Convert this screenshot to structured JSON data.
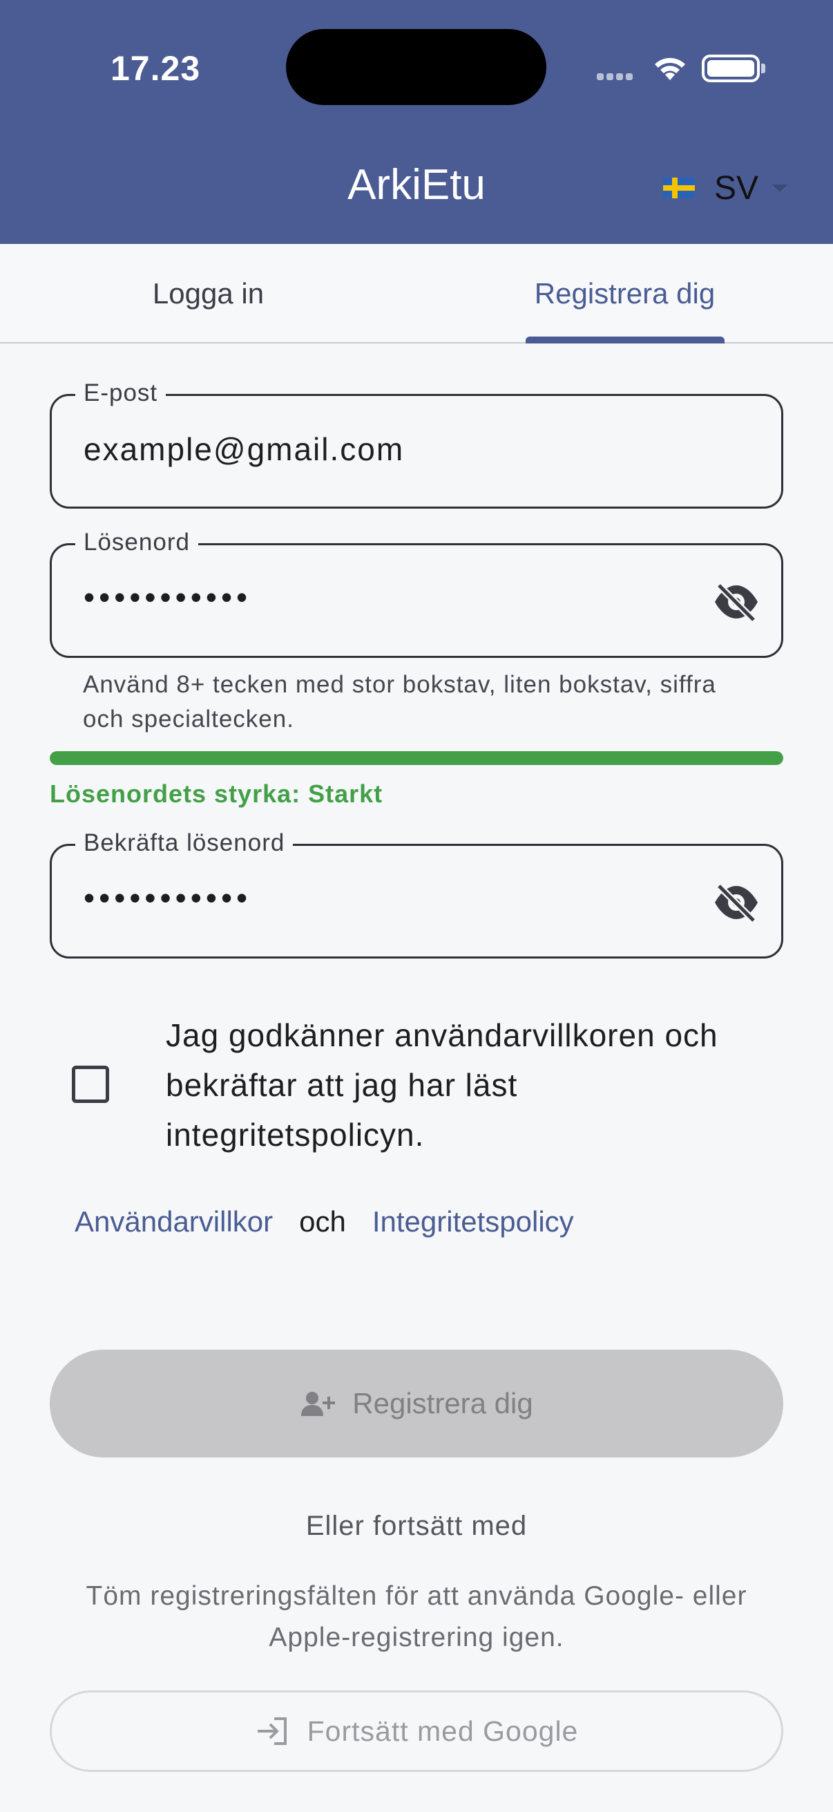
{
  "status_bar": {
    "time": "17.23"
  },
  "header": {
    "title": "ArkiEtu",
    "language_code": "SV"
  },
  "tabs": [
    {
      "label": "Logga in",
      "selected": false
    },
    {
      "label": "Registrera dig",
      "selected": true
    }
  ],
  "form": {
    "email": {
      "label": "E-post",
      "value": "example@gmail.com"
    },
    "password": {
      "label": "Lösenord",
      "value_masked": "•••••••••••",
      "hint": "Använd 8+ tecken med stor bokstav, liten bokstav, siffra och specialtecken.",
      "strength_text": "Lösenordets styrka: Starkt",
      "strength_fraction": 1.0,
      "strength_color": "#43a047"
    },
    "confirm_password": {
      "label": "Bekräfta lösenord",
      "value_masked": "•••••••••••"
    },
    "consent": {
      "checked": false,
      "text": "Jag godkänner användarvillkoren och bekräftar att jag har läst integritetspolicyn."
    },
    "links": {
      "terms": "Användarvillkor",
      "and": "och",
      "privacy": "Integritetspolicy"
    },
    "register_button": {
      "label": "Registrera dig",
      "icon": "person-add-icon",
      "enabled": false
    }
  },
  "alternatives": {
    "or_text": "Eller fortsätt med",
    "clear_hint": "Töm registreringsfälten för att använda Google- eller Apple-registrering igen.",
    "google_button": {
      "label": "Fortsätt med Google",
      "icon": "login-arrow-icon",
      "enabled": false
    }
  },
  "colors": {
    "brand": "#4a5c93",
    "background": "#f6f7f9",
    "success": "#43a047",
    "disabled_button": "#c6c6c8"
  }
}
